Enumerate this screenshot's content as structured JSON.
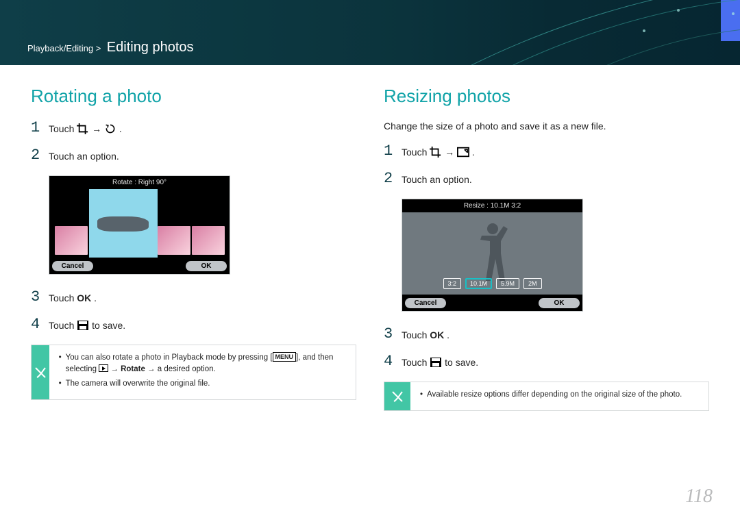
{
  "header": {
    "breadcrumb_prefix": "Playback/Editing >",
    "section_title": "Editing photos"
  },
  "left": {
    "title": "Rotating a photo",
    "steps": {
      "s1_pre": "Touch ",
      "s1_arrow": " → ",
      "s1_post": ".",
      "s2": "Touch an option.",
      "s3_pre": "Touch ",
      "s3_bold": "OK",
      "s3_post": ".",
      "s4_pre": "Touch ",
      "s4_post": " to save."
    },
    "screenshot": {
      "header_text": "Rotate : Right 90°",
      "cancel": "Cancel",
      "ok": "OK"
    },
    "tip": {
      "line1_a": "You can also rotate a photo in Playback mode by pressing [",
      "line1_menu": "MENU",
      "line1_b": "], and then selecting ",
      "line1_rotate": "Rotate",
      "line1_c": " → a desired option.",
      "line2": "The camera will overwrite the original file."
    }
  },
  "right": {
    "title": "Resizing photos",
    "intro": "Change the size of a photo and save it as a new file.",
    "steps": {
      "s1_pre": "Touch ",
      "s1_arrow": " → ",
      "s1_post": ".",
      "s2": "Touch an option.",
      "s3_pre": "Touch ",
      "s3_bold": "OK",
      "s3_post": ".",
      "s4_pre": "Touch ",
      "s4_post": " to save."
    },
    "screenshot": {
      "header_text": "Resize : 10.1M 3:2",
      "opts": [
        "3:2",
        "10.1M",
        "5.9M",
        "2M"
      ],
      "cancel": "Cancel",
      "ok": "OK"
    },
    "tip": {
      "line1": "Available resize options differ depending on the original size of the photo."
    }
  },
  "page_number": "118",
  "icons": {
    "crop": "crop-icon",
    "rotate": "rotate-icon",
    "resize": "resize-icon",
    "save": "save-icon",
    "arrow": "→"
  }
}
